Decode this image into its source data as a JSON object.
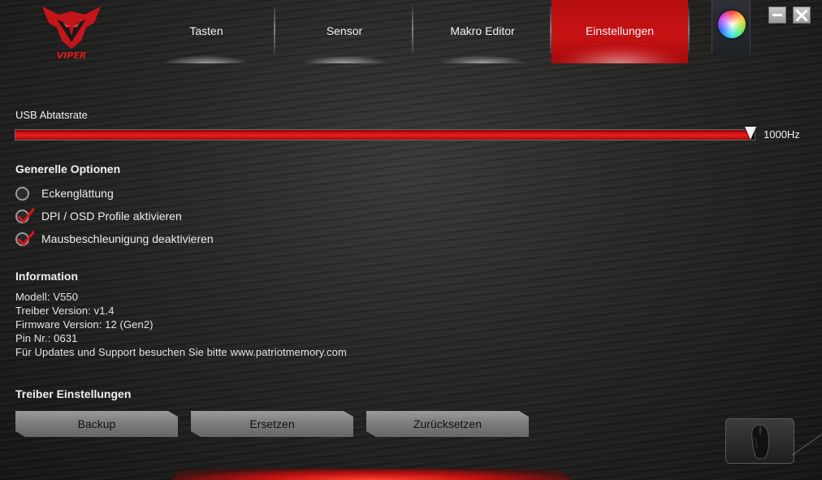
{
  "brand": {
    "logo_text": "VIPER"
  },
  "nav": {
    "tabs": [
      {
        "label": "Tasten",
        "active": false
      },
      {
        "label": "Sensor",
        "active": false
      },
      {
        "label": "Makro Editor",
        "active": false
      },
      {
        "label": "Einstellungen",
        "active": true
      }
    ]
  },
  "polling": {
    "label": "USB Abtatsrate",
    "value_text": "1000Hz",
    "level_fraction": 0.993
  },
  "options": {
    "title": "Generelle Optionen",
    "items": [
      {
        "label": "Eckenglättung",
        "checked": false
      },
      {
        "label": "DPI / OSD Profile aktivieren",
        "checked": true
      },
      {
        "label": "Mausbeschleunigung deaktivieren",
        "checked": true
      }
    ]
  },
  "information": {
    "title": "Information",
    "lines": [
      "Modell: V550",
      "Treiber Version: v1.4",
      "Firmware Version: 12 (Gen2)",
      "Pin Nr.: 0631",
      "Für Updates und Support besuchen Sie bitte www.patriotmemory.com"
    ]
  },
  "driver": {
    "title": "Treiber Einstellungen",
    "buttons": [
      "Backup",
      "Ersetzen",
      "Zurücksetzen"
    ]
  },
  "colors": {
    "accent_red": "#c71214",
    "button_gray": "#8a8a8a",
    "text": "#f0f0f0"
  },
  "icons": {
    "color_wheel": "color-wheel-icon",
    "minimize": "minimize-icon",
    "close": "close-icon",
    "mouse": "mouse-icon",
    "check": "checkmark-icon"
  }
}
